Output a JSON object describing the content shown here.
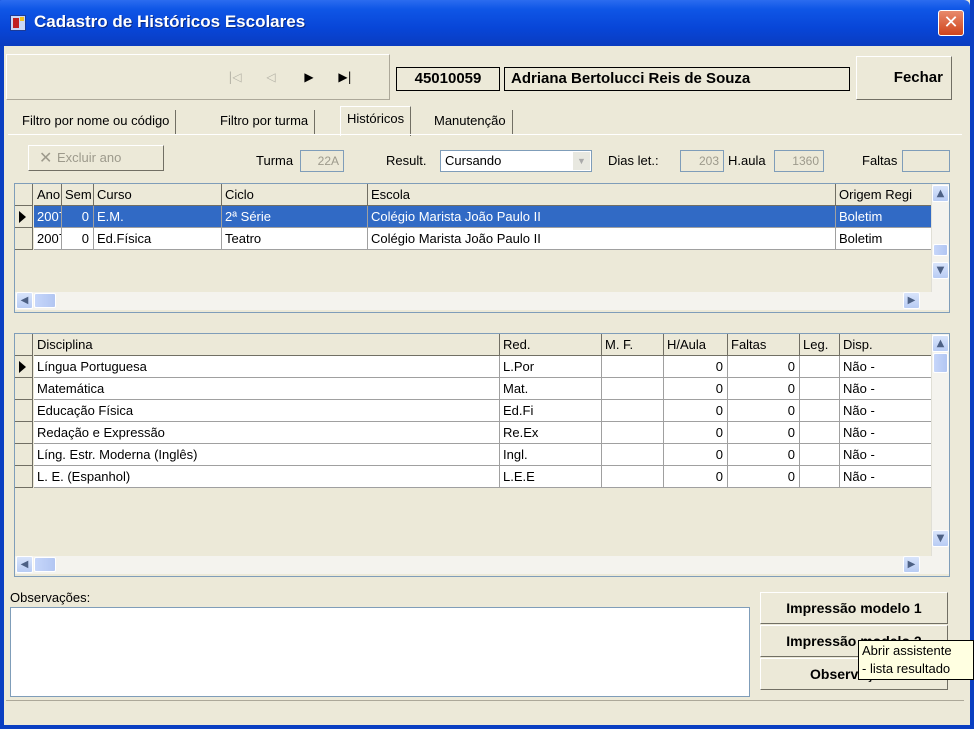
{
  "window": {
    "title": "Cadastro de Históricos Escolares",
    "close_glyph": "✕"
  },
  "nav": {
    "first": "|◁",
    "prev": "◁",
    "next": "▶",
    "last": "▶|",
    "student_code": "45010059",
    "student_name": "Adriana Bertolucci Reis de Souza",
    "close_label": "Fechar"
  },
  "tabs": [
    "Filtro por nome ou código",
    "Filtro por turma",
    "Históricos",
    "Manutenção"
  ],
  "active_tab": "Históricos",
  "toolbar": {
    "excluir_label": "Excluir ano",
    "turma_label": "Turma",
    "turma_value": "22A",
    "result_label": "Result.",
    "result_value": "Cursando",
    "dias_label": "Dias let.:",
    "dias_value": "203",
    "haula_label": "H.aula",
    "haula_value": "1360",
    "faltas_label": "Faltas",
    "faltas_value": ""
  },
  "years_grid": {
    "columns": [
      "Ano",
      "Sem",
      "Curso",
      "Ciclo",
      "Escola",
      "Origem Regi"
    ],
    "rows": [
      [
        "2007",
        "0",
        "E.M.",
        "2ª Série",
        "Colégio Marista João Paulo II",
        "Boletim"
      ],
      [
        "2007",
        "0",
        "Ed.Física",
        "Teatro",
        "Colégio Marista João Paulo II",
        "Boletim"
      ]
    ],
    "selected_row": 0
  },
  "subjects_grid": {
    "columns": [
      "Disciplina",
      "Red.",
      "M. F.",
      "H/Aula",
      "Faltas",
      "Leg.",
      "Disp."
    ],
    "rows": [
      [
        "Língua Portuguesa",
        "L.Por",
        "",
        "0",
        "0",
        "",
        "Não -"
      ],
      [
        "Matemática",
        "Mat.",
        "",
        "0",
        "0",
        "",
        "Não -"
      ],
      [
        "Educação Física",
        "Ed.Fi",
        "",
        "0",
        "0",
        "",
        "Não -"
      ],
      [
        "Redação e Expressão",
        "Re.Ex",
        "",
        "0",
        "0",
        "",
        "Não -"
      ],
      [
        "Líng. Estr. Moderna (Inglês)",
        "Ingl.",
        "",
        "0",
        "0",
        "",
        "Não -"
      ],
      [
        "L. E. (Espanhol)",
        "L.E.E",
        "",
        "0",
        "0",
        "",
        "Não -"
      ]
    ],
    "current_row": 0
  },
  "observations": {
    "label": "Observações:",
    "value": ""
  },
  "buttons": {
    "print1": "Impressão modelo 1",
    "print2": "Impressão modelo 2",
    "obs": "Observações"
  },
  "tooltip": {
    "line1": "Abrir assistente",
    "line2": "- lista resultado"
  },
  "colors": {
    "title_bar": "#0846d8",
    "selection": "#316ac5",
    "face": "#ece9d8"
  }
}
